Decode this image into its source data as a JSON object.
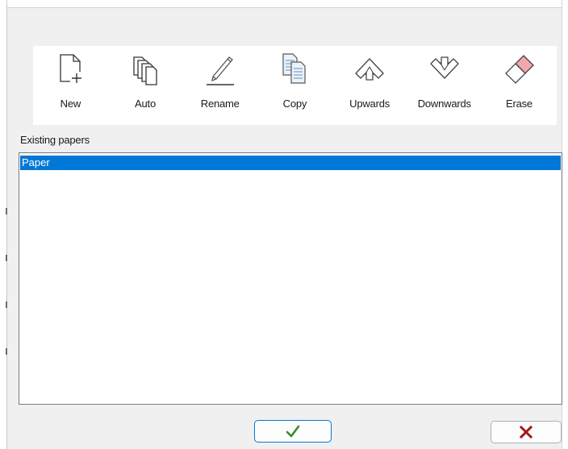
{
  "toolbar": {
    "items": [
      {
        "label": "New",
        "icon": "new-page-icon"
      },
      {
        "label": "Auto",
        "icon": "stacked-pages-icon"
      },
      {
        "label": "Rename",
        "icon": "pencil-icon"
      },
      {
        "label": "Copy",
        "icon": "copy-icon"
      },
      {
        "label": "Upwards",
        "icon": "arrow-up-icon"
      },
      {
        "label": "Downwards",
        "icon": "arrow-down-icon"
      },
      {
        "label": "Erase",
        "icon": "eraser-icon"
      }
    ]
  },
  "papers": {
    "label": "Existing papers",
    "items": [
      {
        "name": "Paper",
        "selected": true
      }
    ]
  },
  "buttons": {
    "ok_icon": "check-icon",
    "cancel_icon": "x-icon"
  },
  "colors": {
    "selection": "#0078d7",
    "ok_check": "#3a8a2a",
    "cancel_x": "#a01a1a"
  }
}
